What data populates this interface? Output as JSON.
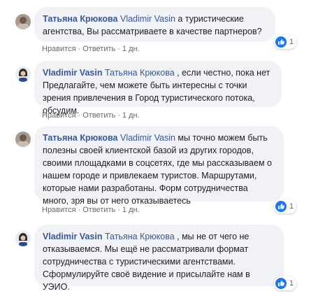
{
  "colors": {
    "bubble": "#f0f2f5",
    "link": "#385898",
    "meta": "#65676b",
    "like": "#1877f2"
  },
  "comments": [
    {
      "author": "Татьяна Крюкова",
      "mention": "Vladimir Vasin",
      "text": " а туристические агентства, Вы рассматриваете в качестве партнеров?",
      "like_label": "Нравится",
      "reply_label": "Ответить",
      "time": "1 дн.",
      "reactions": "1",
      "reaction_icon": "like-icon"
    },
    {
      "author": "Vladimir Vasin",
      "mention": "Татьяна Крюкова",
      "text": " , если честно, пока нет Предлагайте, чем можете быть интересны с точки зрения привлечения в Город туристического потока, обсудим.",
      "like_label": "Нравится",
      "reply_label": "Ответить",
      "time": "1 дн."
    },
    {
      "author": "Татьяна Крюкова",
      "mention": "Vladimir Vasin",
      "text": " мы точно можем быть полезны своей клиентской базой из других городов, своими площадками в соцсетях, где мы рассказываем о нашем городе и привлекаем туристов. Маршрутами, которые нами разработаны. Форм сотрудничества много, зря вы от него отказываетесь",
      "like_label": "Нравится",
      "reply_label": "Ответить",
      "time": "1 дн.",
      "reactions": "1",
      "reaction_icon": "like-icon"
    },
    {
      "author": "Vladimir Vasin",
      "mention": "Татьяна Крюкова",
      "text": " , мы не от чего не отказываемся. Мы ещё не рассматривали формат сотрудничества с туристическими агентствами. Сформулируйте своё видение и присылайте нам в УЭИО.",
      "like_label": "Нравится",
      "reply_label": "Ответить",
      "time": "1 дн.",
      "reactions": "1",
      "reaction_icon": "like-icon"
    }
  ]
}
